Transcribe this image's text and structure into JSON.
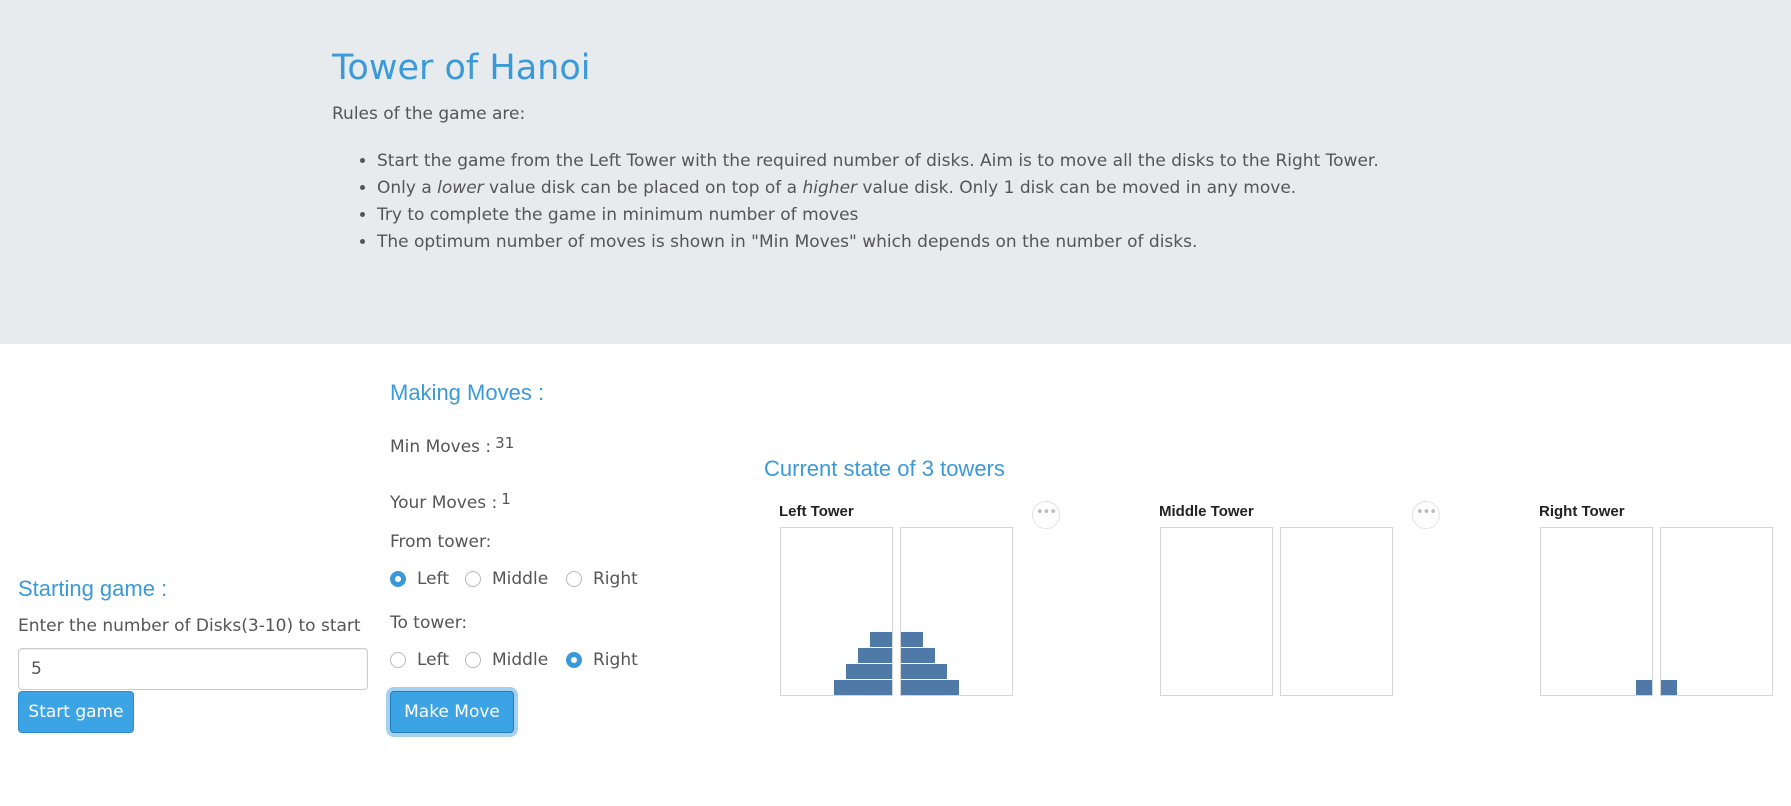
{
  "header": {
    "title": "Tower of Hanoi",
    "intro": "Rules of the game are:",
    "rules": [
      {
        "parts": [
          "Start the game from the Left Tower with the required number of disks. Aim is to move all the disks to the Right Tower."
        ]
      },
      {
        "parts": [
          "Only a ",
          "lower",
          " value disk can be placed on top of a ",
          "higher",
          " value disk. Only 1 disk can be moved in any move."
        ]
      },
      {
        "parts": [
          "Try to complete the game in minimum number of moves"
        ]
      },
      {
        "parts": [
          "The optimum number of moves is shown in \"Min Moves\" which depends on the number of disks."
        ]
      }
    ]
  },
  "starting": {
    "heading": "Starting game :",
    "prompt": "Enter the number of Disks(3-10) to start",
    "disks_value": "5",
    "start_label": "Start game"
  },
  "moves": {
    "heading": "Making Moves :",
    "min_label": "Min Moves :",
    "min_value": "31",
    "your_label": "Your Moves :",
    "your_value": "1",
    "from_label": "From tower:",
    "to_label": "To tower:",
    "options": [
      "Left",
      "Middle",
      "Right"
    ],
    "from_selected": "Left",
    "to_selected": "Right",
    "make_move_label": "Make Move"
  },
  "state": {
    "heading": "Current state of 3 towers",
    "towers": [
      {
        "name": "Left Tower",
        "disks": [
          4,
          3,
          2,
          1
        ],
        "more_icon": "ellipsis-icon"
      },
      {
        "name": "Middle Tower",
        "disks": [],
        "more_icon": "ellipsis-icon"
      },
      {
        "name": "Right Tower",
        "disks": [
          0.5
        ]
      }
    ],
    "disk_color": "#4f79a6"
  },
  "colors": {
    "accent": "#3a9ad9",
    "jumbotron_bg": "#e8ebee",
    "button_bg": "#3ca3e5"
  }
}
